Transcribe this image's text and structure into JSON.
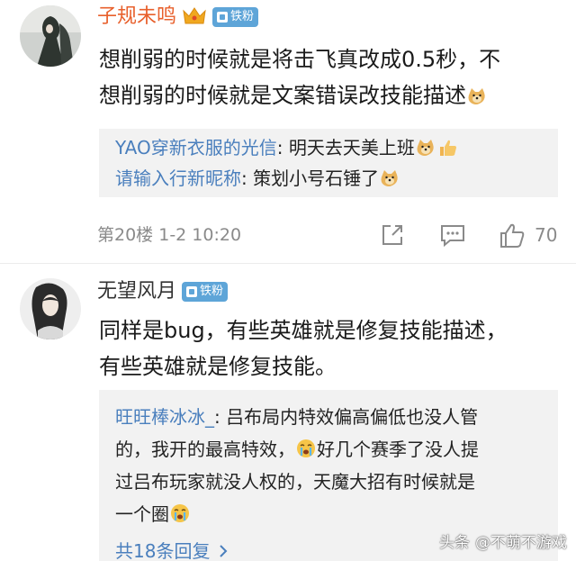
{
  "comments": [
    {
      "username": "子规未鸣",
      "badge": "铁粉",
      "text_line1": "想削弱的时候就是将击飞真改成0.5秒，不",
      "text_line2": "想削弱的时候就是文案错误改技能描述",
      "replies": [
        {
          "name": "YAO穿新衣服的光信",
          "sep": ": ",
          "text": "明天去天美上班"
        },
        {
          "name": "请输入行新昵称",
          "sep": ": ",
          "text": "策划小号石锤了"
        }
      ],
      "floor": "第20楼",
      "time": "1-2 10:20",
      "likes": "70"
    },
    {
      "username": "无望风月",
      "badge": "铁粉",
      "text_line1": "同样是bug，有些英雄就是修复技能描述，",
      "text_line2": "有些英雄就是修复技能。",
      "reply": {
        "name": "旺旺棒冰冰_",
        "sep": ": ",
        "line1": "吕布局内特效偏高偏低也没人管",
        "line2a": "的，我开的最高特效，",
        "line2b": "好几个赛季了没人提",
        "line3": "过吕布玩家就没人权的，天魔大招有时候就是",
        "line4": "一个圈"
      },
      "more_replies": "共18条回复"
    }
  ],
  "watermark": {
    "source": "头条",
    "author": "@不萌不游戏"
  },
  "colors": {
    "vip_name": "#e8602c",
    "link_blue": "#4a7fbd",
    "badge_blue": "#5ea5d8",
    "reply_bg": "#f2f2f2",
    "meta_gray": "#8a8a8a"
  }
}
